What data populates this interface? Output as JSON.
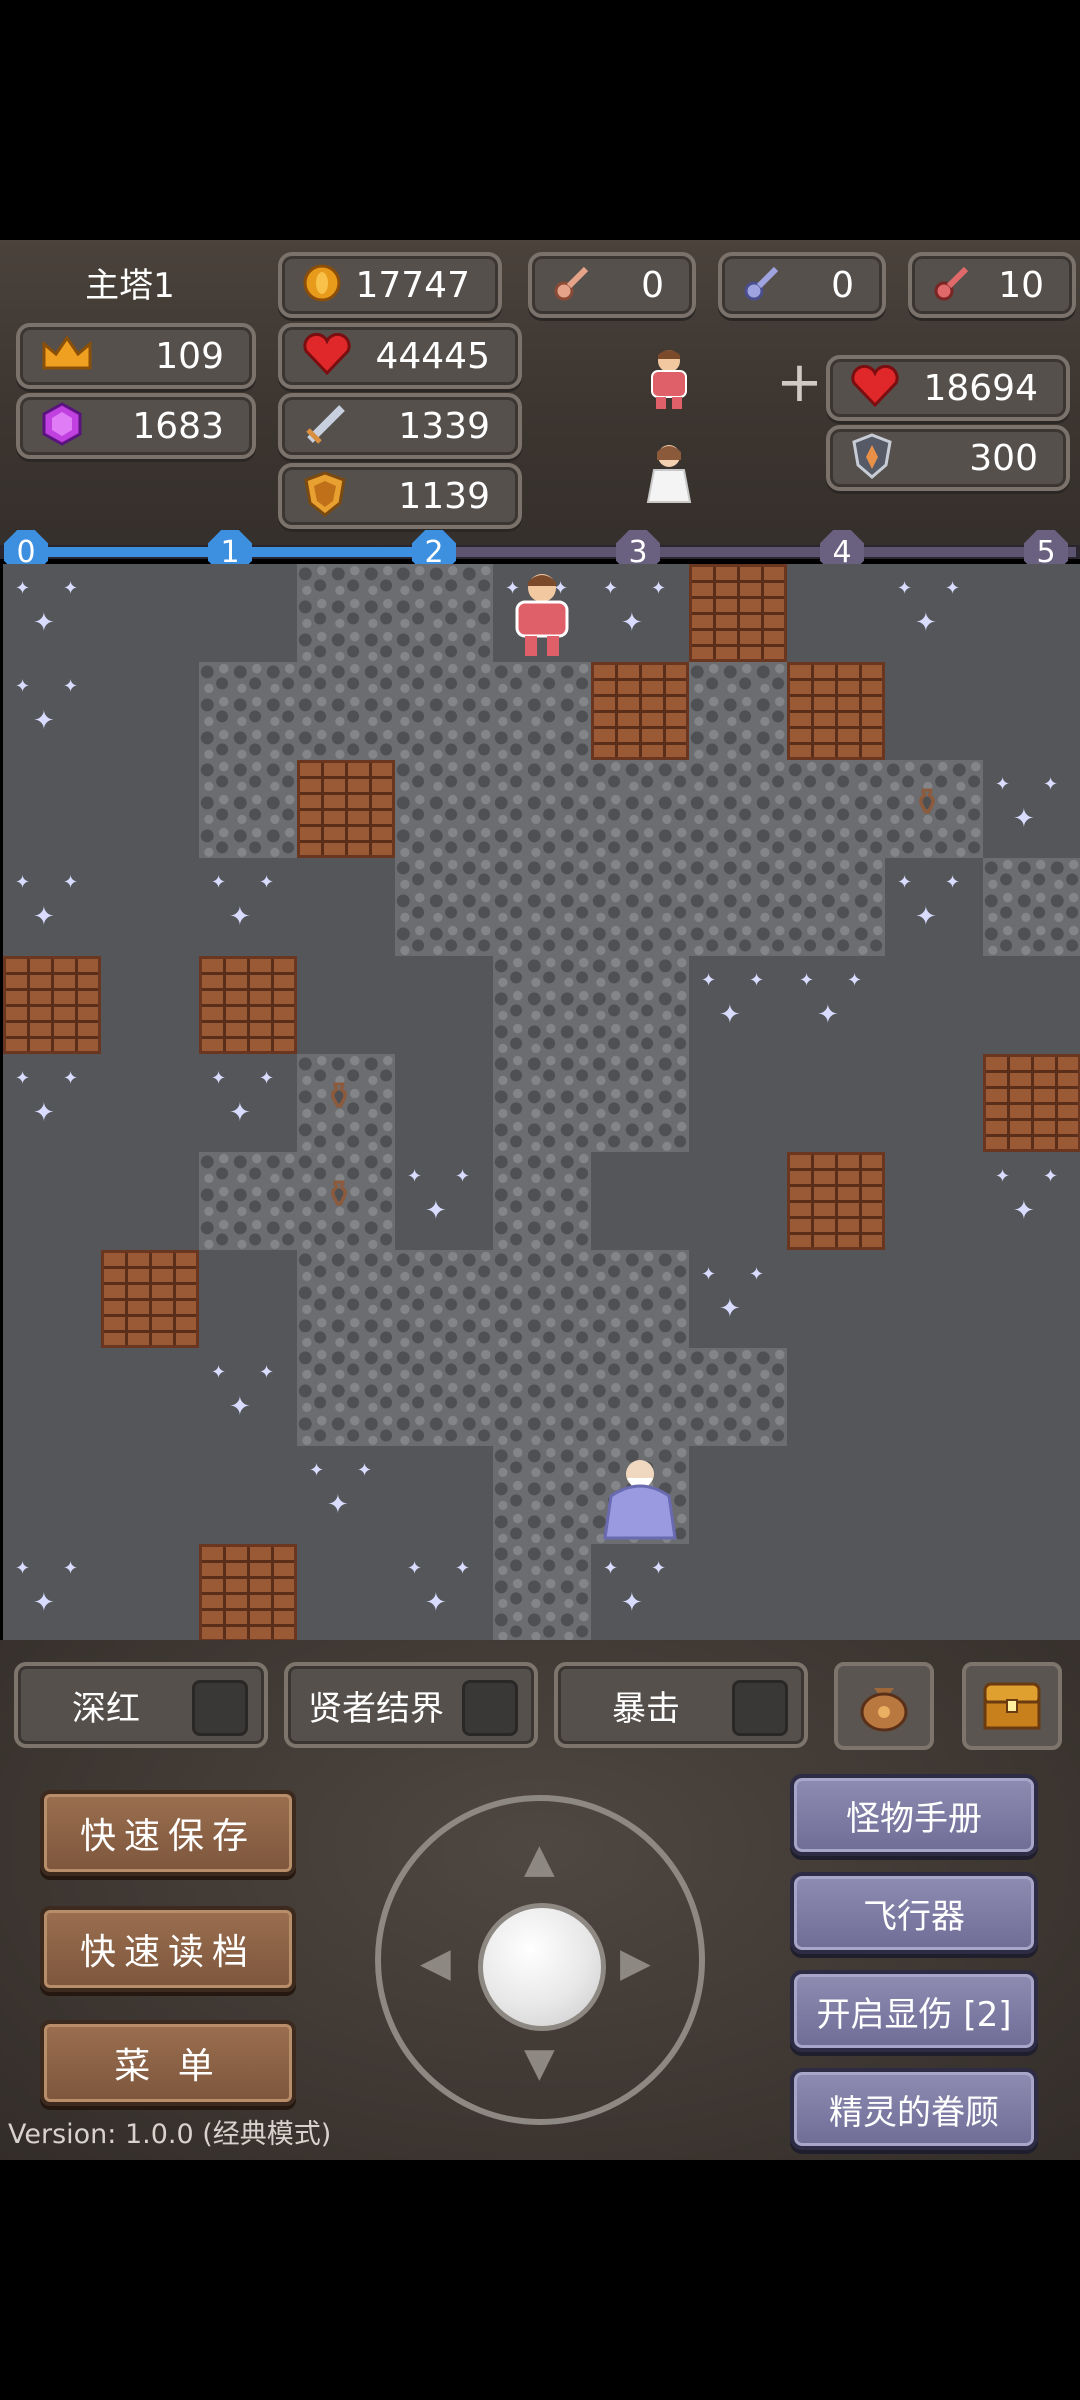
{
  "hud": {
    "floor_name": "主塔1",
    "gold": "17747",
    "level": "109",
    "gems": "1683",
    "hp": "44445",
    "attack": "1339",
    "defense": "1139",
    "yellow_keys": "0",
    "blue_keys": "0",
    "red_keys": "10",
    "bonus_hp": "18694",
    "bonus_def": "300",
    "plus_sign": "+"
  },
  "progress": {
    "nodes": [
      "0",
      "1",
      "2",
      "3",
      "4",
      "5"
    ],
    "current_fraction": 0.4
  },
  "toggles": [
    {
      "label": "深红"
    },
    {
      "label": "贤者结界"
    },
    {
      "label": "暴击"
    }
  ],
  "left_buttons": {
    "quick_save": "快速保存",
    "quick_load": "快速读档",
    "menu": "菜 单"
  },
  "right_buttons": {
    "monster_book": "怪物手册",
    "fly": "飞行器",
    "show_damage": "开启显伤 [2]",
    "fairy": "精灵的眷顾"
  },
  "version": "Version: 1.0.0 (经典模式)",
  "icons": {
    "bag": "bag-icon",
    "chest": "chest-icon",
    "gold": "coin-icon",
    "level": "crown-icon",
    "gem": "gem-icon",
    "hp": "heart-icon",
    "atk": "sword-icon",
    "def": "shield-icon"
  },
  "colors": {
    "progress_active": "#3d8fe0",
    "progress_inactive": "#5d5570",
    "brick": "#9a5a36",
    "floor": "#54565a"
  }
}
